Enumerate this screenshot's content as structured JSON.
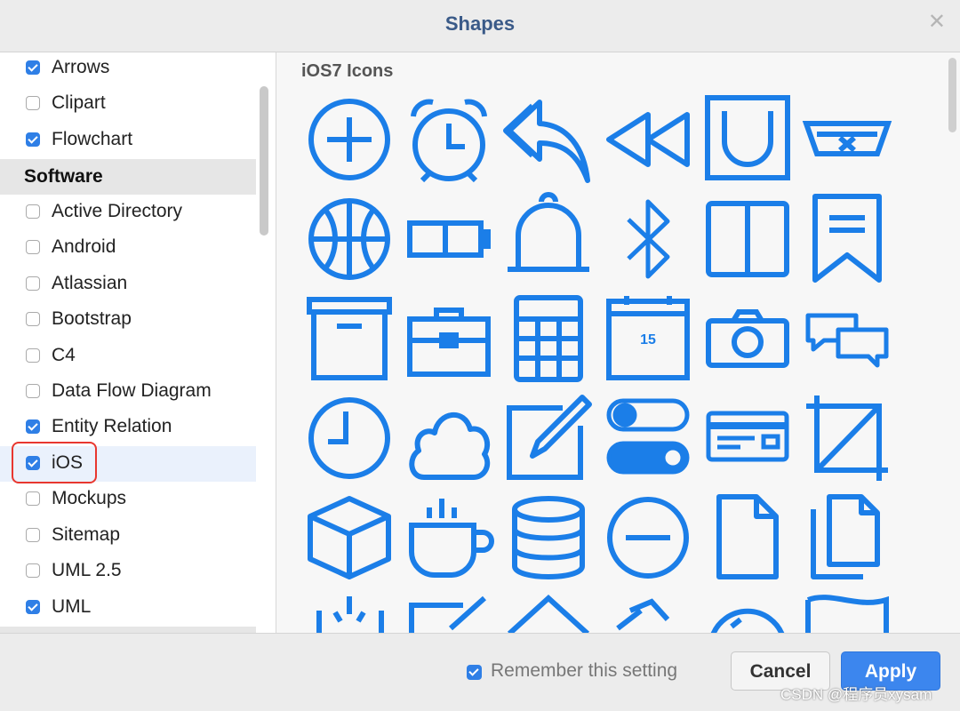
{
  "dialog": {
    "title": "Shapes"
  },
  "left_panel": {
    "items_top": [
      {
        "label": "Arrows",
        "checked": true
      },
      {
        "label": "Clipart",
        "checked": false
      },
      {
        "label": "Flowchart",
        "checked": true
      }
    ],
    "section": "Software",
    "items": [
      {
        "label": "Active Directory",
        "checked": false
      },
      {
        "label": "Android",
        "checked": false
      },
      {
        "label": "Atlassian",
        "checked": false
      },
      {
        "label": "Bootstrap",
        "checked": false
      },
      {
        "label": "C4",
        "checked": false
      },
      {
        "label": "Data Flow Diagram",
        "checked": false
      },
      {
        "label": "Entity Relation",
        "checked": true
      },
      {
        "label": "iOS",
        "checked": true
      },
      {
        "label": "Mockups",
        "checked": false
      },
      {
        "label": "Sitemap",
        "checked": false
      },
      {
        "label": "UML 2.5",
        "checked": false
      },
      {
        "label": "UML",
        "checked": true
      }
    ]
  },
  "gallery": {
    "title": "iOS7 Icons",
    "calendar_day": "15",
    "icon_color": "#1b7ee8",
    "icons": [
      "plus-circle-icon",
      "alarm-clock-icon",
      "reply-all-icon",
      "rewind-icon",
      "magnet-box-icon",
      "basket-icon",
      "basketball-icon",
      "battery-icon",
      "bell-icon",
      "bluetooth-icon",
      "book-icon",
      "bookmark-icon",
      "archive-box-icon",
      "briefcase-icon",
      "calculator-icon",
      "calendar-icon",
      "camera-icon",
      "chat-bubbles-icon",
      "clock-icon",
      "cloud-icon",
      "compose-icon",
      "toggles-icon",
      "credit-card-icon",
      "crop-icon",
      "cube-icon",
      "coffee-cup-icon",
      "database-icon",
      "minus-circle-icon",
      "document-icon",
      "documents-icon"
    ]
  },
  "footer": {
    "remember_label": "Remember this setting",
    "remember_checked": true,
    "cancel_label": "Cancel",
    "apply_label": "Apply",
    "watermark": "CSDN @程序员xysam"
  },
  "colors": {
    "accent": "#2f7fe6",
    "highlight": "#e8372f",
    "title": "#3a5a88"
  }
}
